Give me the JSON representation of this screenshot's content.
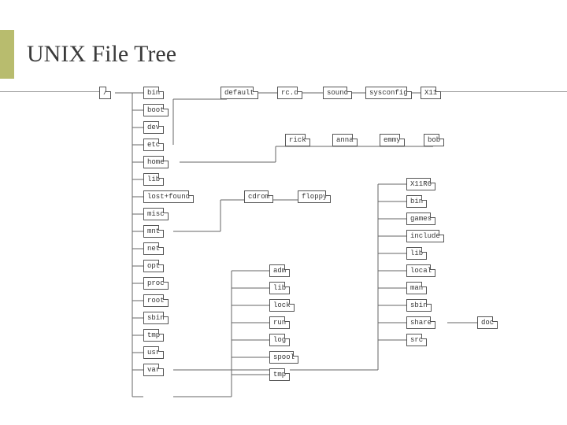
{
  "title": "UNIX File Tree",
  "nodes": {
    "root": "/",
    "bin": "bin",
    "boot": "boot",
    "dev": "dev",
    "etc": "etc",
    "home": "home",
    "lib": "lib",
    "lostfound": "lost+found",
    "misc": "misc",
    "mnt": "mnt",
    "net": "net",
    "opt": "opt",
    "proc": "proc",
    "root_dir": "root",
    "sbin": "sbin",
    "tmp": "tmp",
    "usr": "usr",
    "var": "var",
    "default": "default",
    "rcd": "rc.d",
    "sound": "sound",
    "sysconfig": "sysconfig",
    "X": "X11",
    "rick": "rick",
    "anna": "anna",
    "emmy": "emmy",
    "bob": "bob",
    "cdrom": "cdrom",
    "floppy": "floppy",
    "X11R6": "X11R6",
    "usr_bin": "bin",
    "games": "games",
    "include": "include",
    "usr_lib": "lib",
    "local": "local",
    "usr_man": "man",
    "usr_sbin": "sbin",
    "share": "share",
    "src": "src",
    "doc": "doc",
    "adm": "adm",
    "var_lib": "lib",
    "lock": "lock",
    "run": "run",
    "log": "log",
    "spool": "spool",
    "var_tmp": "tmp"
  }
}
